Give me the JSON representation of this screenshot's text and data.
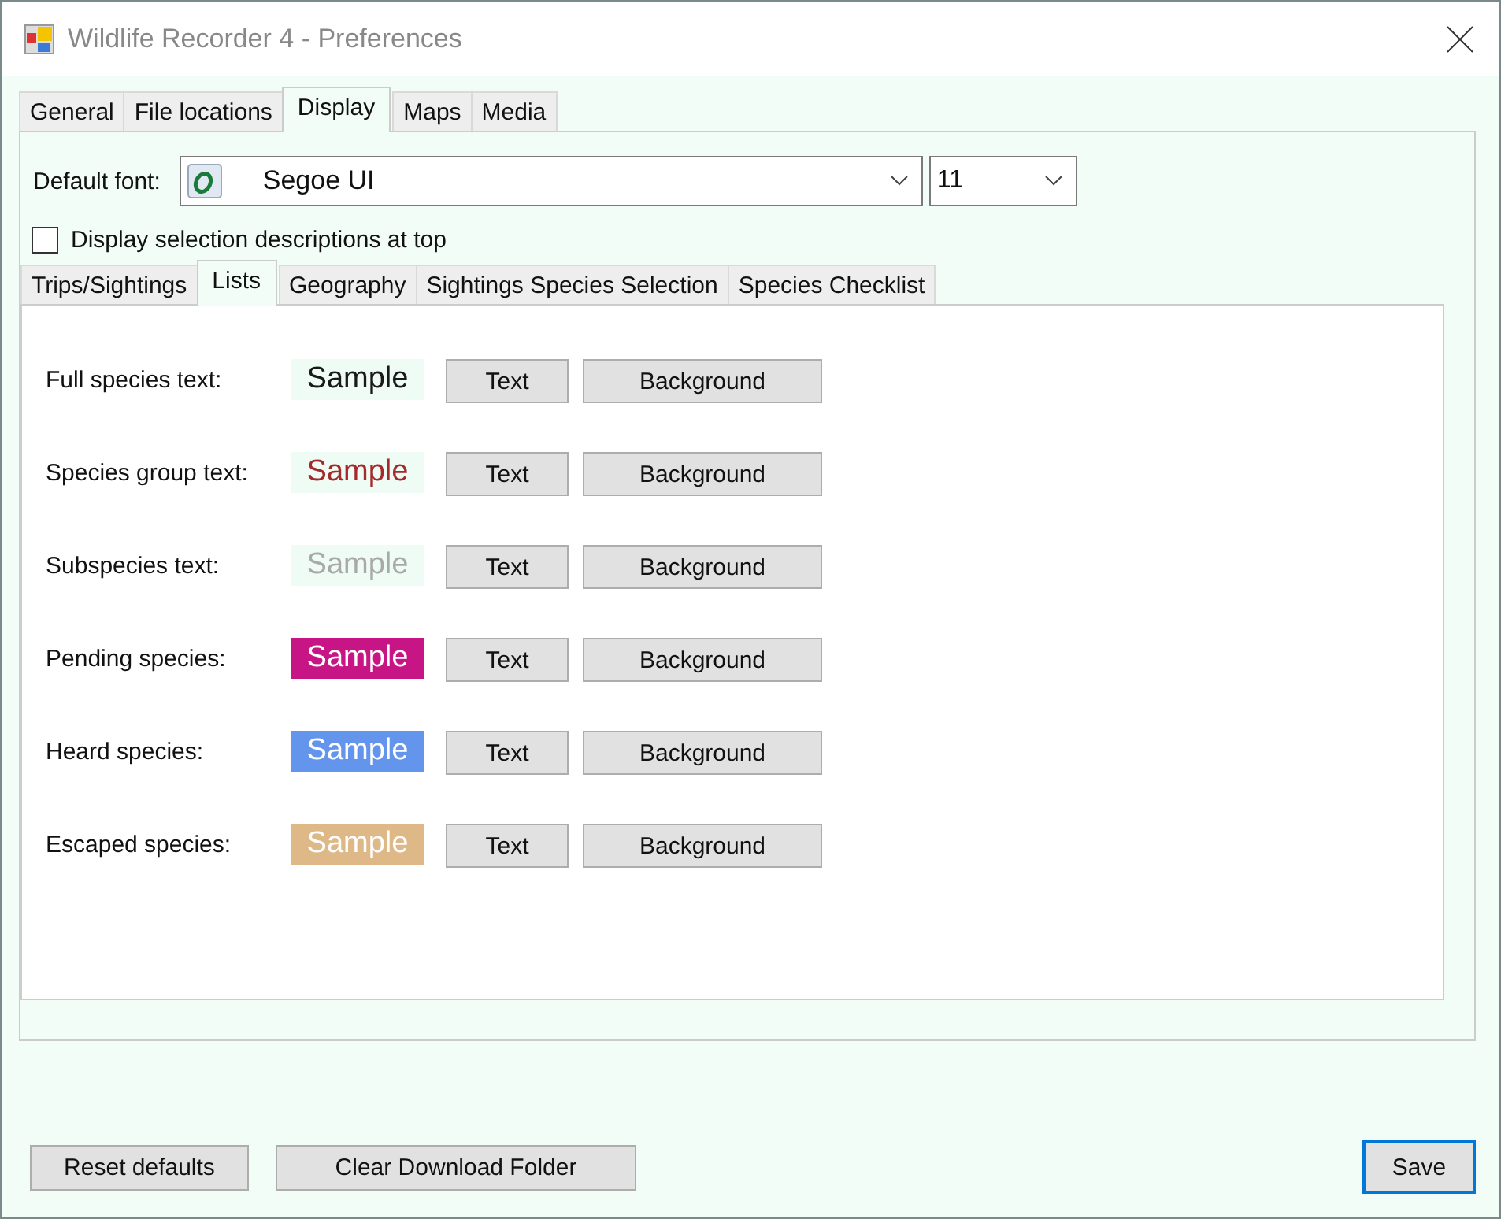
{
  "window": {
    "title": "Wildlife Recorder 4 - Preferences"
  },
  "tabs": [
    {
      "label": "General",
      "selected": false
    },
    {
      "label": "File locations",
      "selected": false
    },
    {
      "label": "Display",
      "selected": true
    },
    {
      "label": "Maps",
      "selected": false
    },
    {
      "label": "Media",
      "selected": false
    }
  ],
  "default_font": {
    "label": "Default font:",
    "value": "Segoe UI",
    "size": "11"
  },
  "display_descriptions_at_top": {
    "label": "Display selection descriptions at top",
    "checked": false
  },
  "subtabs": [
    {
      "label": "Trips/Sightings",
      "selected": false
    },
    {
      "label": "Lists",
      "selected": true
    },
    {
      "label": "Geography",
      "selected": false
    },
    {
      "label": "Sightings Species Selection",
      "selected": false
    },
    {
      "label": "Species Checklist",
      "selected": false
    }
  ],
  "rows": [
    {
      "label": "Full species text:",
      "sample": {
        "text": "Sample",
        "color": "#1a1a1a"
      },
      "color": "#eefcf5",
      "buttons": [
        "Text",
        "Background"
      ]
    },
    {
      "label": "Species group text:",
      "sample": {
        "text": "Sample",
        "color": "#a52a2a"
      },
      "color": "#eefcf5",
      "buttons": [
        "Text",
        "Background"
      ]
    },
    {
      "label": "Subspecies text:",
      "sample": {
        "text": "Sample",
        "color": "#a9a9a9"
      },
      "color": "#eefcf5",
      "buttons": [
        "Text",
        "Background"
      ]
    },
    {
      "label": "Pending species:",
      "sample": {
        "text": "Sample",
        "color": "#ffffff"
      },
      "color": "#c71585",
      "buttons": [
        "Text",
        "Background"
      ]
    },
    {
      "label": "Heard species:",
      "sample": {
        "text": "Sample",
        "color": "#ffffff"
      },
      "color": "#6495ed",
      "buttons": [
        "Text",
        "Background"
      ]
    },
    {
      "label": "Escaped species:",
      "sample": {
        "text": "Sample",
        "color": "#ffffff"
      },
      "color": "#deb887",
      "buttons": [
        "Text",
        "Background"
      ]
    }
  ],
  "footer_buttons": [
    {
      "label": "Reset defaults",
      "default": false
    },
    {
      "label": "Clear Download Folder",
      "default": false
    },
    {
      "label": "Save",
      "default": true
    }
  ]
}
